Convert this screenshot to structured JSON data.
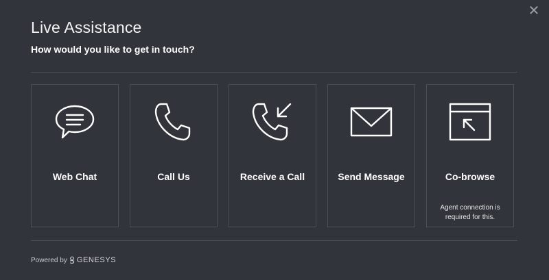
{
  "header": {
    "title": "Live Assistance",
    "subtitle": "How would you like to get in touch?"
  },
  "options": [
    {
      "label": "Web Chat",
      "icon": "chat-bubble-icon"
    },
    {
      "label": "Call Us",
      "icon": "phone-icon"
    },
    {
      "label": "Receive a Call",
      "icon": "incoming-call-icon"
    },
    {
      "label": "Send Message",
      "icon": "envelope-icon"
    },
    {
      "label": "Co-browse",
      "icon": "cobrowse-window-icon",
      "note": "Agent connection is required for this."
    }
  ],
  "footer": {
    "powered_by": "Powered by",
    "brand": "GENESYS",
    "brand_icon": "genesys-logo-icon"
  },
  "close_icon": "close-icon",
  "colors": {
    "background": "#31343a",
    "border": "#4b4f56",
    "text": "#ffffff"
  }
}
